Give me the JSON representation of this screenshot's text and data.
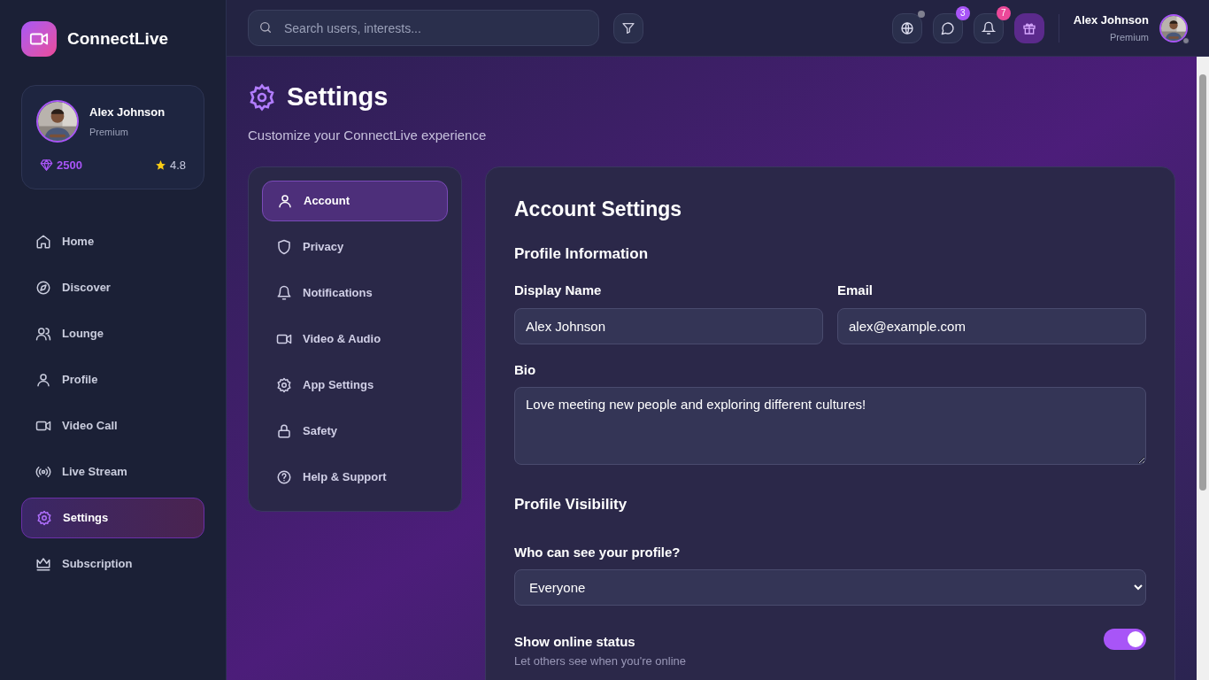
{
  "app": {
    "name": "ConnectLive"
  },
  "profile_card": {
    "name": "Alex Johnson",
    "tier": "Premium",
    "gems": "2500",
    "rating": "4.8"
  },
  "nav": [
    {
      "label": "Home",
      "selected": false
    },
    {
      "label": "Discover",
      "selected": false
    },
    {
      "label": "Lounge",
      "selected": false
    },
    {
      "label": "Profile",
      "selected": false
    },
    {
      "label": "Video Call",
      "selected": false
    },
    {
      "label": "Live Stream",
      "selected": false
    },
    {
      "label": "Settings",
      "selected": true
    },
    {
      "label": "Subscription",
      "selected": false
    }
  ],
  "header": {
    "search": {
      "placeholder": "Search users, interests..."
    },
    "messages_badge": "3",
    "notifications_badge": "7",
    "user": {
      "name": "Alex Johnson",
      "tier": "Premium"
    }
  },
  "page": {
    "title": "Settings",
    "subtitle": "Customize your ConnectLive experience"
  },
  "settings_menu": [
    {
      "label": "Account",
      "selected": true
    },
    {
      "label": "Privacy",
      "selected": false
    },
    {
      "label": "Notifications",
      "selected": false
    },
    {
      "label": "Video & Audio",
      "selected": false
    },
    {
      "label": "App Settings",
      "selected": false
    },
    {
      "label": "Safety",
      "selected": false
    },
    {
      "label": "Help & Support",
      "selected": false
    }
  ],
  "account": {
    "title": "Account Settings",
    "profile_section": "Profile Information",
    "fields": [
      {
        "label": "Display Name",
        "value": "Alex Johnson"
      },
      {
        "label": "Email",
        "value": "alex@example.com"
      }
    ],
    "bio": {
      "label": "Bio",
      "value": "Love meeting new people and exploring different cultures!"
    },
    "visibility_section": "Profile Visibility",
    "visibility": {
      "label": "Who can see your profile?",
      "value": "Everyone"
    },
    "toggles": [
      {
        "label": "Show online status",
        "description": "Let others see when you're online",
        "on": true
      }
    ]
  }
}
